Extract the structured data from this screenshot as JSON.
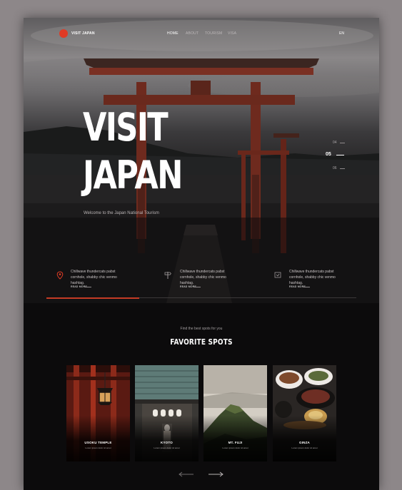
{
  "nav": {
    "logo": "VISIT JAPAN",
    "links": [
      "HOME",
      "ABOUT",
      "TOURISM",
      "VISA"
    ],
    "lang": "EN"
  },
  "hero": {
    "title_line1": "VISIT",
    "title_line2": "JAPAN",
    "subtitle": "Welcome to the Japan National Tourism",
    "slides": [
      "04",
      "05",
      "06"
    ],
    "active_slide": "05"
  },
  "features": [
    {
      "icon": "location-pin-icon",
      "text": "Chillwave thundercats pabst cornhole, shabby chic venmo hashtag.",
      "link": "READ MORE"
    },
    {
      "icon": "signpost-icon",
      "text": "Chillwave thundercats pabst cornhole, shabby chic venmo hashtag.",
      "link": "READ MORE"
    },
    {
      "icon": "map-icon",
      "text": "Chillwave thundercats pabst cornhole, shabby chic venmo hashtag.",
      "link": "READ MORE"
    }
  ],
  "progress": 0.3,
  "spots": {
    "eyebrow": "Find the best spots for you",
    "title": "FAVORITE SPOTS",
    "cards": [
      {
        "name": "USOKU TEMPLE",
        "desc": "Lorem ipsum dolor sit amet"
      },
      {
        "name": "KYOTO",
        "desc": "Lorem ipsum dolor sit amet"
      },
      {
        "name": "MT. FUJI",
        "desc": "Lorem ipsum dolor sit amet"
      },
      {
        "name": "GINZA",
        "desc": "Lorem ipsum dolor sit amet"
      }
    ]
  },
  "colors": {
    "accent": "#e03b25",
    "progress": "#c53b25",
    "background": "#0c0b0c"
  }
}
